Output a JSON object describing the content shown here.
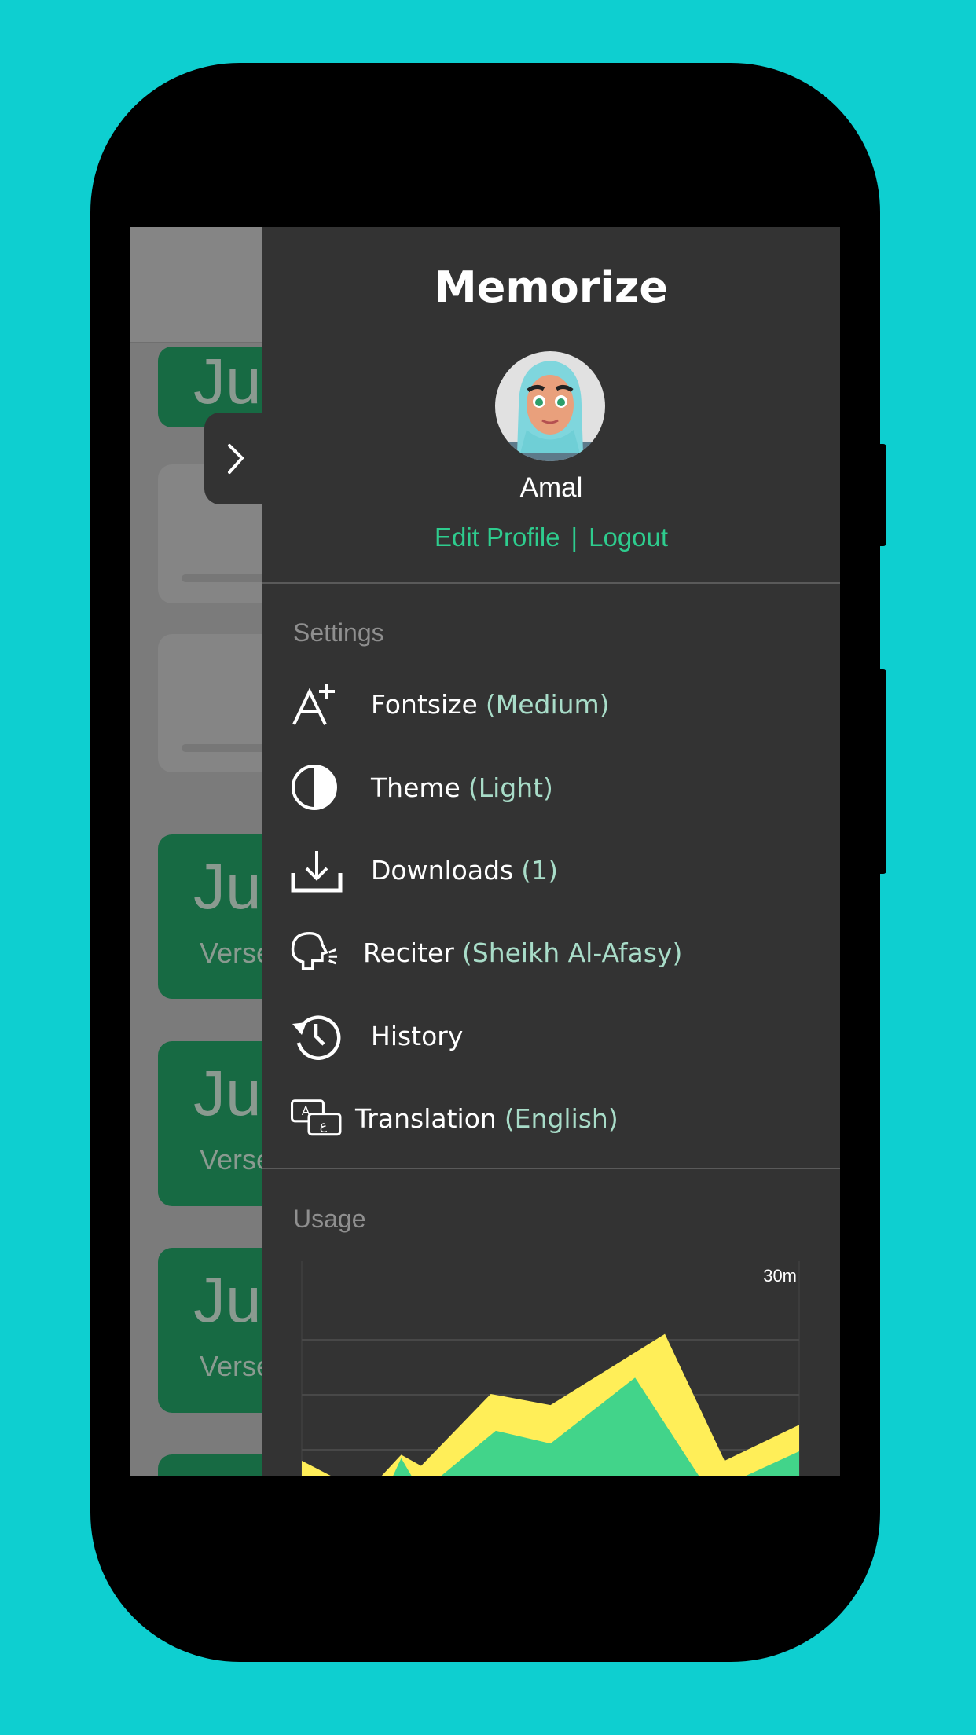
{
  "colors": {
    "background": "#0ecfd0",
    "drawer": "#333333",
    "accent": "#2ecc8e",
    "value_text": "#a8dcc8",
    "chart_yellow": "#ffee58",
    "chart_green": "#42d48a"
  },
  "background_list": {
    "cards": [
      {
        "title": "Juz'"
      },
      {
        "title": "Juz",
        "subtitle": "Verse"
      },
      {
        "title": "Juz",
        "subtitle": "Verse"
      },
      {
        "title": "Juz",
        "subtitle": "Verse"
      }
    ]
  },
  "drawer": {
    "toggle_icon": "chevron-right-icon",
    "title": "Memorize",
    "user": {
      "name": "Amal",
      "edit_profile": "Edit Profile",
      "separator": "|",
      "logout": "Logout"
    },
    "settings_label": "Settings",
    "items": [
      {
        "icon": "font-size-increase-icon",
        "label": "Fontsize",
        "value": "(Medium)"
      },
      {
        "icon": "theme-contrast-icon",
        "label": "Theme",
        "value": "(Light)"
      },
      {
        "icon": "download-icon",
        "label": "Downloads",
        "value": "(1)"
      },
      {
        "icon": "reciter-speaking-head-icon",
        "label": "Reciter",
        "value": "(Sheikh Al-Afasy)"
      },
      {
        "icon": "history-icon",
        "label": "History",
        "value": ""
      },
      {
        "icon": "translation-icon",
        "label": "Translation",
        "value": "(English)"
      }
    ],
    "usage_label": "Usage"
  },
  "chart_data": {
    "type": "area",
    "ylabel_top": "30m",
    "ylim": [
      0,
      30
    ],
    "grid": true,
    "series": [
      {
        "color": "#ffee58",
        "points": [
          [
            0,
            6.7
          ],
          [
            0.6,
            4.9
          ],
          [
            1.6,
            4.9
          ],
          [
            2.0,
            7.4
          ],
          [
            2.4,
            6.1
          ],
          [
            3.8,
            14.5
          ],
          [
            5.0,
            13.2
          ],
          [
            7.3,
            21.5
          ],
          [
            8.5,
            6.7
          ],
          [
            10,
            10.9
          ]
        ]
      },
      {
        "color": "#42d48a",
        "points": [
          [
            0,
            2
          ],
          [
            1.6,
            2
          ],
          [
            2.0,
            7
          ],
          [
            2.4,
            3
          ],
          [
            3.9,
            10.2
          ],
          [
            5.0,
            8.7
          ],
          [
            6.7,
            16.4
          ],
          [
            8.2,
            3
          ],
          [
            10,
            7.8
          ]
        ]
      }
    ]
  }
}
